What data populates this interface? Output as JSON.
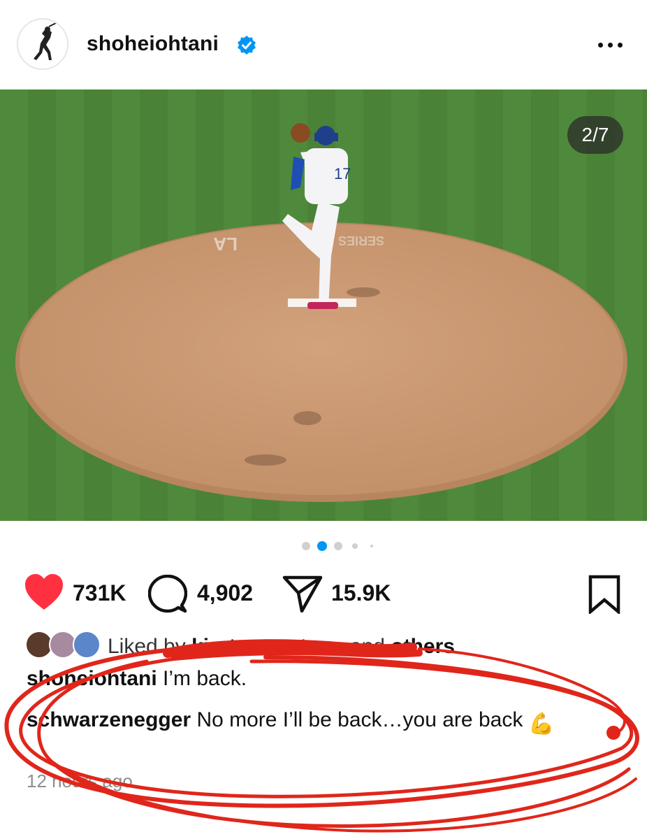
{
  "post": {
    "username": "shoheiohtani",
    "verified_icon": "verified-badge-icon",
    "image_counter": "2/7",
    "carousel_dots": 5,
    "carousel_active_index": 1
  },
  "actions": {
    "likes": "731K",
    "comments": "4,902",
    "shares": "15.9K"
  },
  "liked_by": {
    "prefix": "Liked by",
    "user": "kirsten_watson",
    "suffix": "and",
    "others": "others"
  },
  "caption": {
    "username": "shoheiohtani",
    "text": "I’m back."
  },
  "top_comment": {
    "username": "schwarzenegger",
    "text": "No more I’ll be back…you are back",
    "emoji": "💪"
  },
  "timestamp": "12 hours ago",
  "colors": {
    "like_red": "#ff3040",
    "verified_blue": "#0095f6",
    "scribble_red": "#e0261b"
  }
}
